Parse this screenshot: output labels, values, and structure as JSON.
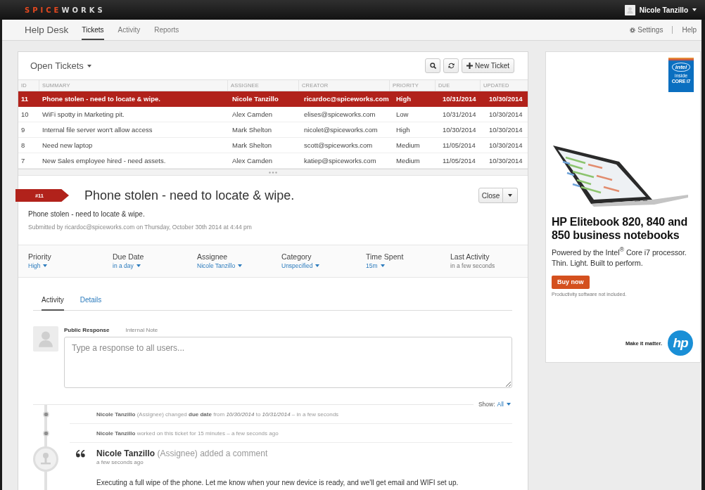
{
  "top_bar": {
    "logo": [
      {
        "text": "SPICE",
        "color": "#e4481f"
      },
      {
        "text": "WORKS",
        "color": "#d9d9d9"
      }
    ],
    "user": {
      "name": "Nicole Tanzillo"
    }
  },
  "nav": {
    "title": "Help Desk",
    "tabs": [
      {
        "label": "Tickets",
        "selected": true
      },
      {
        "label": "Activity",
        "selected": false
      },
      {
        "label": "Reports",
        "selected": false
      }
    ],
    "links": [
      {
        "label": "Settings",
        "kind": "settings"
      },
      {
        "label": "Help",
        "kind": "plain"
      }
    ]
  },
  "tickets": {
    "title": "Open Tickets",
    "new_ticket_button": "New Ticket",
    "table": {
      "columns": [
        "ID",
        "SUMMARY",
        "ASSIGNEE",
        "CREATOR",
        "PRIORITY",
        "DUE",
        "UPDATED"
      ],
      "rows": [
        {
          "selected": true,
          "cells": [
            "11",
            "Phone stolen - need to locate & wipe.",
            "Nicole Tanzillo",
            "ricardoc@spiceworks.com",
            "High",
            "10/31/2014",
            "10/30/2014"
          ]
        },
        {
          "selected": false,
          "cells": [
            "10",
            "WiFi spotty in Marketing pit.",
            "Alex Camden",
            "elises@spiceworks.com",
            "Low",
            "10/31/2014",
            "10/30/2014"
          ]
        },
        {
          "selected": false,
          "cells": [
            "9",
            "Internal file server won't allow access",
            "Mark Shelton",
            "nicolet@spiceworks.com",
            "High",
            "10/30/2014",
            "10/30/2014"
          ]
        },
        {
          "selected": false,
          "cells": [
            "8",
            "Need new laptop",
            "Mark Shelton",
            "scott@spiceworks.com",
            "Medium",
            "11/05/2014",
            "10/30/2014"
          ]
        },
        {
          "selected": false,
          "cells": [
            "7",
            "New Sales employee hired - need assets.",
            "Alex Camden",
            "katiep@spiceworks.com",
            "Medium",
            "11/05/2014",
            "10/30/2014"
          ]
        }
      ]
    }
  },
  "ticket": {
    "number": "#11",
    "title": "Phone stolen - need to locate & wipe.",
    "close_button": "Close",
    "description": "Phone stolen - need to locate & wipe.",
    "submitted": "Submitted by ricardoc@spiceworks.com on Thursday, October 30th 2014 at 4:44 pm",
    "fields": [
      {
        "label": "Priority",
        "value": "High",
        "kind": "dropdown"
      },
      {
        "label": "Due Date",
        "value": "in a day",
        "kind": "dropdown"
      },
      {
        "label": "Assignee",
        "value": "Nicole Tanzillo",
        "kind": "dropdown"
      },
      {
        "label": "Category",
        "value": "Unspecified",
        "kind": "dropdown"
      },
      {
        "label": "Time Spent",
        "value": "15m",
        "kind": "dropdown"
      },
      {
        "label": "Last Activity",
        "value": "in a few seconds",
        "kind": "static"
      }
    ]
  },
  "activity": {
    "tabs": [
      {
        "label": "Activity",
        "selected": true
      },
      {
        "label": "Details",
        "selected": false
      }
    ],
    "response_tabs": [
      {
        "label": "Public Response",
        "selected": true
      },
      {
        "label": "Internal Note",
        "selected": false
      }
    ],
    "response": {
      "placeholder": "Type a response to all users..."
    },
    "filter": {
      "label": "Show:",
      "value": "All"
    },
    "timeline": [
      {
        "kind": "event",
        "text": "**Nicole Tanzillo** (Assignee) changed **due date** from *10/30/2014* to *10/31/2014* – in a few seconds"
      },
      {
        "kind": "event",
        "text": "**Nicole Tanzillo** worked on this ticket for 15 minutes – a few seconds ago"
      },
      {
        "kind": "comment",
        "header": "**Nicole Tanzillo** (Assignee) added a comment",
        "time": "a few seconds ago",
        "body": "Executing a full wipe of the phone. Let me know when your new device is ready, and we'll get email and WIFI set up."
      }
    ]
  },
  "ad": {
    "badge": {
      "brand": "intel",
      "line_1": "inside",
      "line_2": "CORE i7"
    },
    "headline": "HP Elitebook 820, 840 and 850 business notebooks",
    "lines": [
      "Powered by the Intel$^{®}$ Core i7 processor.",
      "Thin. Light. Built to perform."
    ],
    "button": "Buy now",
    "disclaimer": "Productivity software not included.",
    "tagline": "Make it matter.",
    "logo": "hp"
  }
}
